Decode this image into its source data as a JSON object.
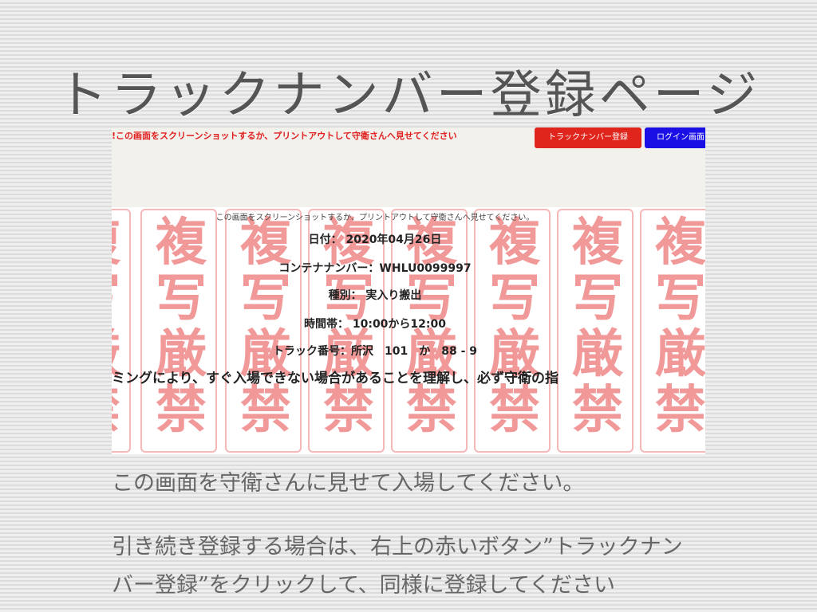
{
  "slide": {
    "title": "トラックナンバー登録ページ",
    "caption_1": "この画面を守衛さんに見せて入場してください。",
    "caption_2_line1": "引き続き登録する場合は、右上の赤いボタン”トラックナン",
    "caption_2_line2": "バー登録”をクリックして、同様に登録してください"
  },
  "screenshot": {
    "top_notice": "!この画面をスクリーンショットするか、プリントアウトして守衛さんへ見せてください",
    "buttons": {
      "register": "トラックナンバー登録",
      "login": "ログイン画面"
    },
    "note": "この画面をスクリーンショットするか、プリントアウトして守衛さんへ見せてください。",
    "date": "日付： 2020年04月26日",
    "container": "コンテナナンバー：WHLU0099997",
    "type": "種別： 実入り搬出",
    "time": "時間帯： 10:00から12:00",
    "truck": "トラック番号：所沢　101　か　88 - 9",
    "warning": "ミングにより、すぐ入場できない場合があることを理解し、必ず守衛の指",
    "watermark": [
      "複",
      "写",
      "厳",
      "禁"
    ]
  },
  "colors": {
    "notice_red": "#e02020",
    "button_red": "#e0261c",
    "button_blue": "#1a10e6",
    "watermark_pink": "#f19999"
  }
}
